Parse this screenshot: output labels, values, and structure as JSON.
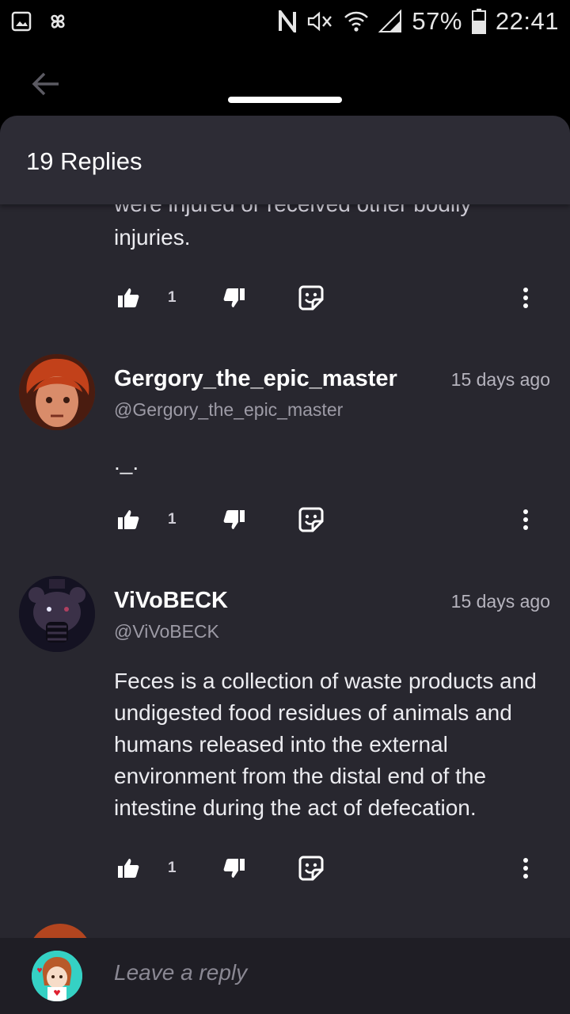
{
  "status_bar": {
    "battery": "57%",
    "time": "22:41"
  },
  "sheet": {
    "title": "19 Replies"
  },
  "peek": {
    "cut_line": "were injured or received other bodily",
    "last_line": "injuries.",
    "like_count": "1"
  },
  "comments": [
    {
      "username": "Gergory_the_epic_master",
      "handle": "@Gergory_the_epic_master",
      "time": "15 days ago",
      "text": "._.",
      "like_count": "1"
    },
    {
      "username": "ViVoBECK",
      "handle": "@ViVoBECK",
      "time": "15 days ago",
      "text": "Feces is a collection of waste products and undigested food residues of animals and humans released into the external environment from the distal end of the intestine during the act of defecation.",
      "like_count": "1"
    }
  ],
  "reply_bar": {
    "placeholder": "Leave a reply"
  },
  "colors": {
    "sheet_bg": "#28272f",
    "header_bg": "#2d2c35",
    "reply_bar_bg": "#1f1e25"
  }
}
